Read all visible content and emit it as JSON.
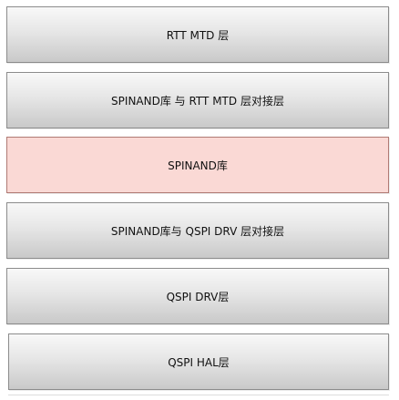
{
  "layers": [
    {
      "label": "RTT MTD 层"
    },
    {
      "label": "SPINAND库 与 RTT MTD 层对接层"
    },
    {
      "label": "SPINAND库"
    },
    {
      "label": "SPINAND库与 QSPI DRV 层对接层"
    },
    {
      "label": "QSPI DRV层"
    },
    {
      "label": "QSPI HAL层"
    }
  ],
  "colors": {
    "layer_gradient_top": "#f8f8f8",
    "layer_gradient_bottom": "#c9c9c9",
    "layer_border": "#8c8c8c",
    "highlight_fill": "#fad9d5",
    "highlight_border": "#b07a74"
  }
}
